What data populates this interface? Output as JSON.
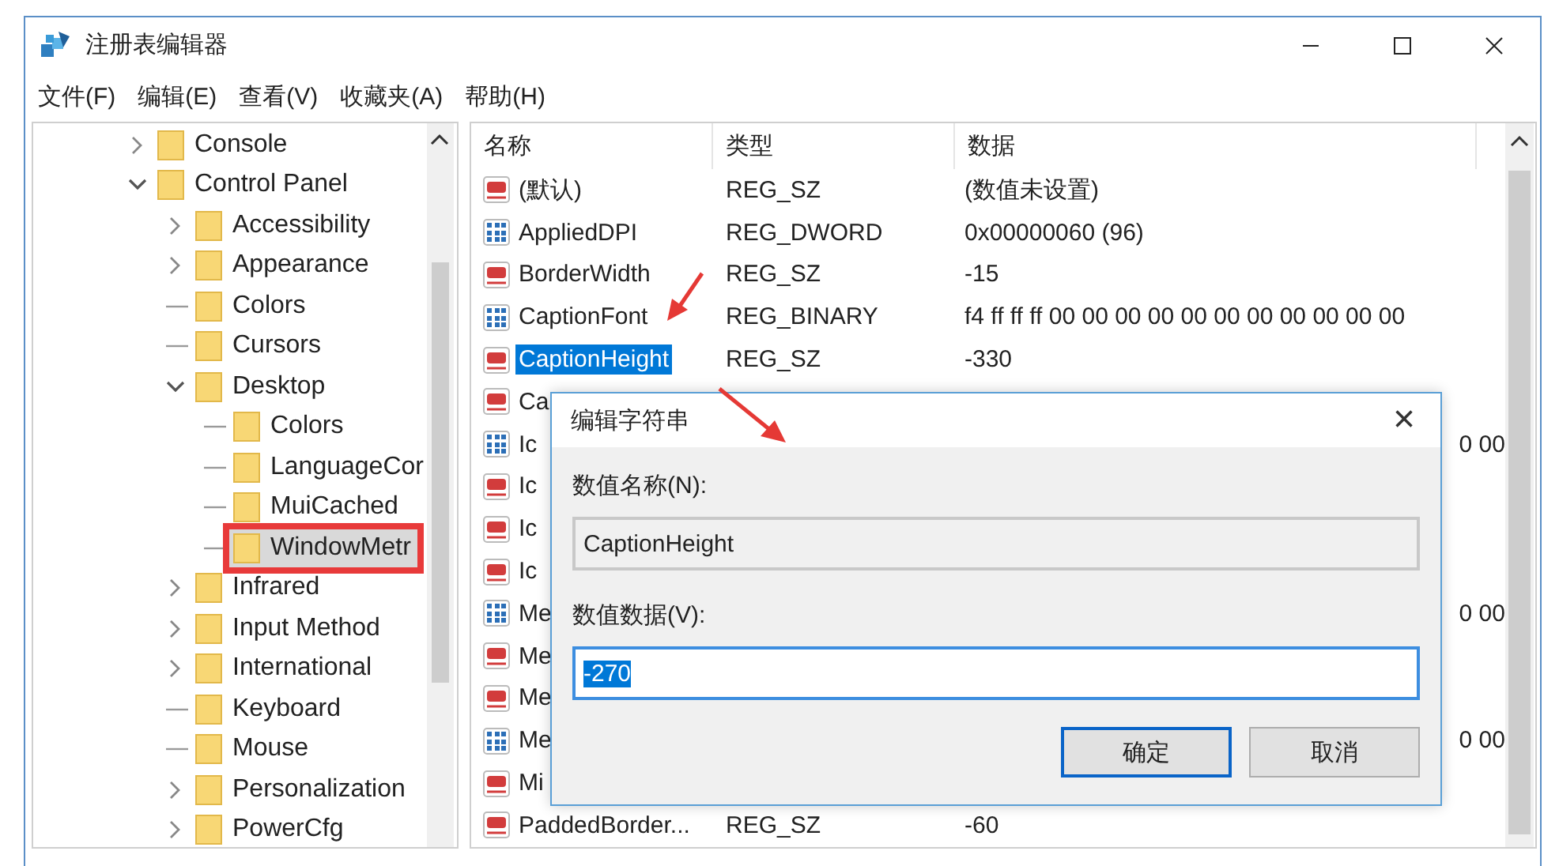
{
  "window": {
    "title": "注册表编辑器",
    "menu": [
      "文件(F)",
      "编辑(E)",
      "查看(V)",
      "收藏夹(A)",
      "帮助(H)"
    ]
  },
  "tree": [
    {
      "label": "Console",
      "kind": "branch",
      "expanded": false,
      "selected": false,
      "marked": false
    },
    {
      "label": "Control Panel",
      "kind": "branch",
      "expanded": true,
      "selected": false,
      "marked": false,
      "children": [
        {
          "label": "Accessibility",
          "kind": "branch",
          "expanded": false,
          "selected": false,
          "marked": false
        },
        {
          "label": "Appearance",
          "kind": "branch",
          "expanded": false,
          "selected": false,
          "marked": false
        },
        {
          "label": "Colors",
          "kind": "leaf",
          "selected": false,
          "marked": false
        },
        {
          "label": "Cursors",
          "kind": "leaf",
          "selected": false,
          "marked": false
        },
        {
          "label": "Desktop",
          "kind": "branch",
          "expanded": true,
          "selected": false,
          "marked": false,
          "children": [
            {
              "label": "Colors",
              "kind": "leaf",
              "selected": false,
              "marked": false
            },
            {
              "label": "LanguageCor",
              "kind": "leaf",
              "selected": false,
              "marked": false
            },
            {
              "label": "MuiCached",
              "kind": "leaf",
              "selected": false,
              "marked": false
            },
            {
              "label": "WindowMetr",
              "kind": "leaf",
              "selected": true,
              "marked": true
            }
          ]
        },
        {
          "label": "Infrared",
          "kind": "branch",
          "expanded": false,
          "selected": false,
          "marked": false
        },
        {
          "label": "Input Method",
          "kind": "branch",
          "expanded": false,
          "selected": false,
          "marked": false
        },
        {
          "label": "International",
          "kind": "branch",
          "expanded": false,
          "selected": false,
          "marked": false
        },
        {
          "label": "Keyboard",
          "kind": "leaf",
          "selected": false,
          "marked": false
        },
        {
          "label": "Mouse",
          "kind": "leaf",
          "selected": false,
          "marked": false
        },
        {
          "label": "Personalization",
          "kind": "branch",
          "expanded": false,
          "selected": false,
          "marked": false
        },
        {
          "label": "PowerCfg",
          "kind": "branch",
          "expanded": false,
          "selected": false,
          "marked": false
        }
      ]
    }
  ],
  "table": {
    "columns": [
      "名称",
      "类型",
      "数据"
    ],
    "rows": [
      {
        "kind": "string",
        "name": "(默认)",
        "type": "REG_SZ",
        "data": "(数值未设置)",
        "selected": false
      },
      {
        "kind": "binary",
        "name": "AppliedDPI",
        "type": "REG_DWORD",
        "data": "0x00000060 (96)",
        "selected": false
      },
      {
        "kind": "string",
        "name": "BorderWidth",
        "type": "REG_SZ",
        "data": "-15",
        "selected": false
      },
      {
        "kind": "binary",
        "name": "CaptionFont",
        "type": "REG_BINARY",
        "data": "f4 ff ff ff 00 00 00 00 00 00 00 00 00 00 00",
        "selected": false
      },
      {
        "kind": "string",
        "name": "CaptionHeight",
        "type": "REG_SZ",
        "data": "-330",
        "selected": true
      },
      {
        "kind": "string",
        "name": "Ca",
        "selected": false
      },
      {
        "kind": "binary",
        "name": "Ic",
        "data": "0 00",
        "selected": false
      },
      {
        "kind": "string",
        "name": "Ic",
        "selected": false
      },
      {
        "kind": "string",
        "name": "Ic",
        "selected": false
      },
      {
        "kind": "string",
        "name": "Ic",
        "selected": false
      },
      {
        "kind": "binary",
        "name": "Me",
        "data": "0 00",
        "selected": false
      },
      {
        "kind": "string",
        "name": "Me",
        "selected": false
      },
      {
        "kind": "string",
        "name": "Me",
        "selected": false
      },
      {
        "kind": "binary",
        "name": "Me",
        "data": "0 00",
        "selected": false
      },
      {
        "kind": "string",
        "name": "Mi",
        "selected": false
      },
      {
        "kind": "string",
        "name": "PaddedBorder...",
        "type": "REG_SZ",
        "data": "-60",
        "selected": false
      }
    ]
  },
  "dialog": {
    "title": "编辑字符串",
    "close": "×",
    "fields": [
      {
        "label": "数值名称(N):",
        "value": "CaptionHeight",
        "readonly": true,
        "text_selected": false
      },
      {
        "label": "数值数据(V):",
        "value": "-270",
        "readonly": false,
        "text_selected": true
      }
    ],
    "buttons": [
      {
        "label": "确定",
        "default": true
      },
      {
        "label": "取消",
        "default": false
      }
    ]
  }
}
